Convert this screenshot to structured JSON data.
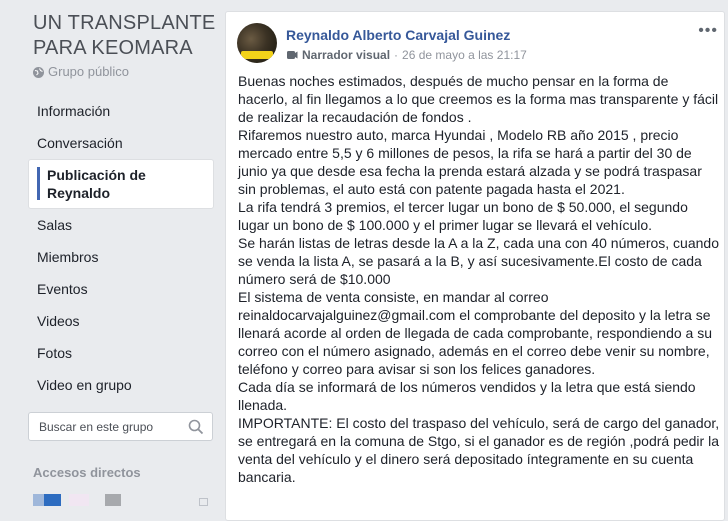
{
  "group": {
    "title_line1": "UN TRANSPLANTE",
    "title_line2": "PARA KEOMARA",
    "privacy": "Grupo público"
  },
  "nav": {
    "items": [
      {
        "label": "Información",
        "active": false
      },
      {
        "label": "Conversación",
        "active": false
      },
      {
        "label": "Publicación de Reynaldo",
        "active": true
      },
      {
        "label": "Salas",
        "active": false
      },
      {
        "label": "Miembros",
        "active": false
      },
      {
        "label": "Eventos",
        "active": false
      },
      {
        "label": "Videos",
        "active": false
      },
      {
        "label": "Fotos",
        "active": false
      },
      {
        "label": "Video en grupo",
        "active": false
      }
    ],
    "active_line1": "Publicación de",
    "active_line2": "Reynaldo"
  },
  "search": {
    "placeholder": "Buscar en este grupo"
  },
  "shortcuts": {
    "title": "Accesos directos"
  },
  "post": {
    "author": "Reynaldo Alberto Carvajal Guinez",
    "role": "Narrador visual",
    "separator": "·",
    "timestamp": "26 de mayo a las 21:17",
    "more_icon": "ellipsis-icon",
    "paragraphs": [
      "Buenas noches estimados, después de mucho pensar en la forma de hacerlo, al fin llegamos a lo que creemos es la forma mas transparente y fácil de realizar la recaudación de fondos .",
      "Rifaremos nuestro auto, marca Hyundai , Modelo RB año 2015 , precio mercado entre 5,5 y 6 millones de pesos, la rifa se hará a partir del 30 de junio ya que desde esa fecha la prenda estará alzada y se podrá traspasar sin problemas, el auto está con patente pagada hasta el 2021.",
      "La rifa tendrá 3 premios, el tercer lugar un bono de $ 50.000, el segundo lugar un bono de $ 100.000 y el primer lugar se llevará el vehículo.",
      "Se harán listas de letras desde la A a la Z, cada una con 40 números, cuando se venda la lista A, se pasará a la B, y así sucesivamente.El costo de cada número será de $10.000",
      "El sistema de venta consiste, en mandar al correo reinaldocarvajalguinez@gmail.com el comprobante del deposito y la letra se llenará acorde al orden de llegada de cada comprobante, respondiendo a su correo con el número asignado, además en el correo debe venir su nombre, teléfono y correo para avisar si son los felices ganadores.",
      "Cada día se informará de los números vendidos y la letra que está siendo llenada.",
      "IMPORTANTE: El costo del traspaso del vehículo, será de cargo del ganador, se entregará en la comuna de Stgo, si el ganador es de región ,podrá pedir la venta del vehículo y el dinero será depositado íntegramente en su cuenta bancaria."
    ]
  }
}
